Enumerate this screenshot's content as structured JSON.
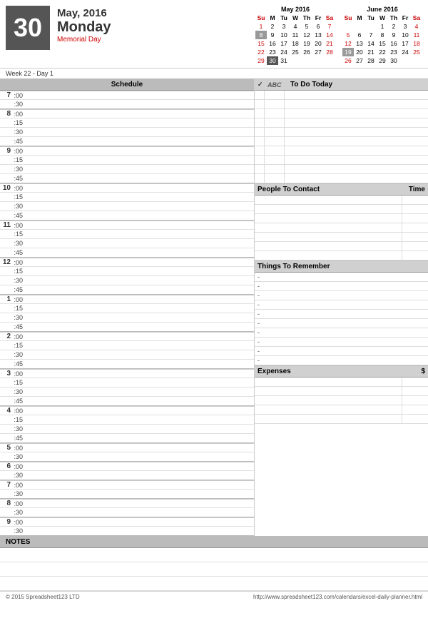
{
  "header": {
    "date_number": "30",
    "month_year": "May, 2016",
    "day_name": "Monday",
    "holiday": "Memorial Day"
  },
  "calendar_may": {
    "title": "May 2016",
    "days_header": [
      "Su",
      "M",
      "Tu",
      "W",
      "Th",
      "Fr",
      "Sa"
    ],
    "weeks": [
      [
        {
          "d": "1",
          "cls": ""
        },
        {
          "d": "2",
          "cls": ""
        },
        {
          "d": "3",
          "cls": ""
        },
        {
          "d": "4",
          "cls": ""
        },
        {
          "d": "5",
          "cls": ""
        },
        {
          "d": "6",
          "cls": ""
        },
        {
          "d": "7",
          "cls": ""
        }
      ],
      [
        {
          "d": "8",
          "cls": "highlighted"
        },
        {
          "d": "9",
          "cls": ""
        },
        {
          "d": "10",
          "cls": ""
        },
        {
          "d": "11",
          "cls": ""
        },
        {
          "d": "12",
          "cls": ""
        },
        {
          "d": "13",
          "cls": ""
        },
        {
          "d": "14",
          "cls": ""
        }
      ],
      [
        {
          "d": "15",
          "cls": ""
        },
        {
          "d": "16",
          "cls": ""
        },
        {
          "d": "17",
          "cls": ""
        },
        {
          "d": "18",
          "cls": ""
        },
        {
          "d": "19",
          "cls": ""
        },
        {
          "d": "20",
          "cls": ""
        },
        {
          "d": "21",
          "cls": ""
        }
      ],
      [
        {
          "d": "22",
          "cls": ""
        },
        {
          "d": "23",
          "cls": ""
        },
        {
          "d": "24",
          "cls": ""
        },
        {
          "d": "25",
          "cls": ""
        },
        {
          "d": "26",
          "cls": ""
        },
        {
          "d": "27",
          "cls": ""
        },
        {
          "d": "28",
          "cls": ""
        }
      ],
      [
        {
          "d": "29",
          "cls": ""
        },
        {
          "d": "30",
          "cls": "today"
        },
        {
          "d": "31",
          "cls": ""
        }
      ]
    ]
  },
  "calendar_june": {
    "title": "June 2016",
    "days_header": [
      "Su",
      "M",
      "Tu",
      "W",
      "Th",
      "Fr",
      "Sa"
    ],
    "weeks": [
      [
        {
          "d": "",
          "cls": "empty"
        },
        {
          "d": "",
          "cls": "empty"
        },
        {
          "d": "",
          "cls": "empty"
        },
        {
          "d": "",
          "cls": "empty"
        },
        {
          "d": "1",
          "cls": ""
        },
        {
          "d": "2",
          "cls": ""
        },
        {
          "d": "3",
          "cls": ""
        },
        {
          "d": "4",
          "cls": ""
        }
      ],
      [
        {
          "d": "5",
          "cls": ""
        },
        {
          "d": "6",
          "cls": ""
        },
        {
          "d": "7",
          "cls": ""
        },
        {
          "d": "8",
          "cls": ""
        },
        {
          "d": "9",
          "cls": ""
        },
        {
          "d": "10",
          "cls": ""
        },
        {
          "d": "11",
          "cls": ""
        }
      ],
      [
        {
          "d": "12",
          "cls": ""
        },
        {
          "d": "13",
          "cls": ""
        },
        {
          "d": "14",
          "cls": ""
        },
        {
          "d": "15",
          "cls": ""
        },
        {
          "d": "16",
          "cls": ""
        },
        {
          "d": "17",
          "cls": ""
        },
        {
          "d": "18",
          "cls": ""
        }
      ],
      [
        {
          "d": "19",
          "cls": "highlighted"
        },
        {
          "d": "20",
          "cls": ""
        },
        {
          "d": "21",
          "cls": ""
        },
        {
          "d": "22",
          "cls": ""
        },
        {
          "d": "23",
          "cls": ""
        },
        {
          "d": "24",
          "cls": ""
        },
        {
          "d": "25",
          "cls": ""
        }
      ],
      [
        {
          "d": "26",
          "cls": ""
        },
        {
          "d": "27",
          "cls": ""
        },
        {
          "d": "28",
          "cls": ""
        },
        {
          "d": "29",
          "cls": ""
        },
        {
          "d": "30",
          "cls": ""
        }
      ]
    ]
  },
  "week_info": "Week 22 - Day 1",
  "schedule": {
    "header": "Schedule",
    "slots": [
      {
        "hour": "7",
        "times": [
          ":00",
          ":30"
        ]
      },
      {
        "hour": "8",
        "times": [
          ":00",
          ":15",
          ":30",
          ":45"
        ]
      },
      {
        "hour": "9",
        "times": [
          ":00",
          ":15",
          ":30",
          ":45"
        ]
      },
      {
        "hour": "10",
        "times": [
          ":00",
          ":15",
          ":30",
          ":45"
        ]
      },
      {
        "hour": "11",
        "times": [
          ":00",
          ":15",
          ":30",
          ":45"
        ]
      },
      {
        "hour": "12",
        "times": [
          ":00",
          ":15",
          ":30",
          ":45"
        ]
      },
      {
        "hour": "1",
        "times": [
          ":00",
          ":15",
          ":30",
          ":45"
        ]
      },
      {
        "hour": "2",
        "times": [
          ":00",
          ":15",
          ":30",
          ":45"
        ]
      },
      {
        "hour": "3",
        "times": [
          ":00",
          ":15",
          ":30",
          ":45"
        ]
      },
      {
        "hour": "4",
        "times": [
          ":00",
          ":15",
          ":30",
          ":45"
        ]
      },
      {
        "hour": "5",
        "times": [
          ":00",
          ":30"
        ]
      },
      {
        "hour": "6",
        "times": [
          ":00",
          ":30"
        ]
      },
      {
        "hour": "7",
        "times": [
          ":00",
          ":30"
        ]
      },
      {
        "hour": "8",
        "times": [
          ":00",
          ":30"
        ]
      },
      {
        "hour": "9",
        "times": [
          ":00",
          ":30"
        ]
      }
    ]
  },
  "todo": {
    "header_check": "✓",
    "header_abc": "ABC",
    "header_label": "To Do Today",
    "rows": 10
  },
  "people_to_contact": {
    "label": "People To Contact",
    "time_label": "Time",
    "rows": 7
  },
  "things_to_remember": {
    "label": "Things To Remember",
    "rows": 10,
    "bullet": "-"
  },
  "expenses": {
    "label": "Expenses",
    "dollar_label": "$",
    "rows": 5
  },
  "notes": {
    "label": "NOTES",
    "rows": 3
  },
  "footer": {
    "left": "© 2015 Spreadsheet123 LTD",
    "right": "http://www.spreadsheet123.com/calendars/excel-daily-planner.html"
  }
}
